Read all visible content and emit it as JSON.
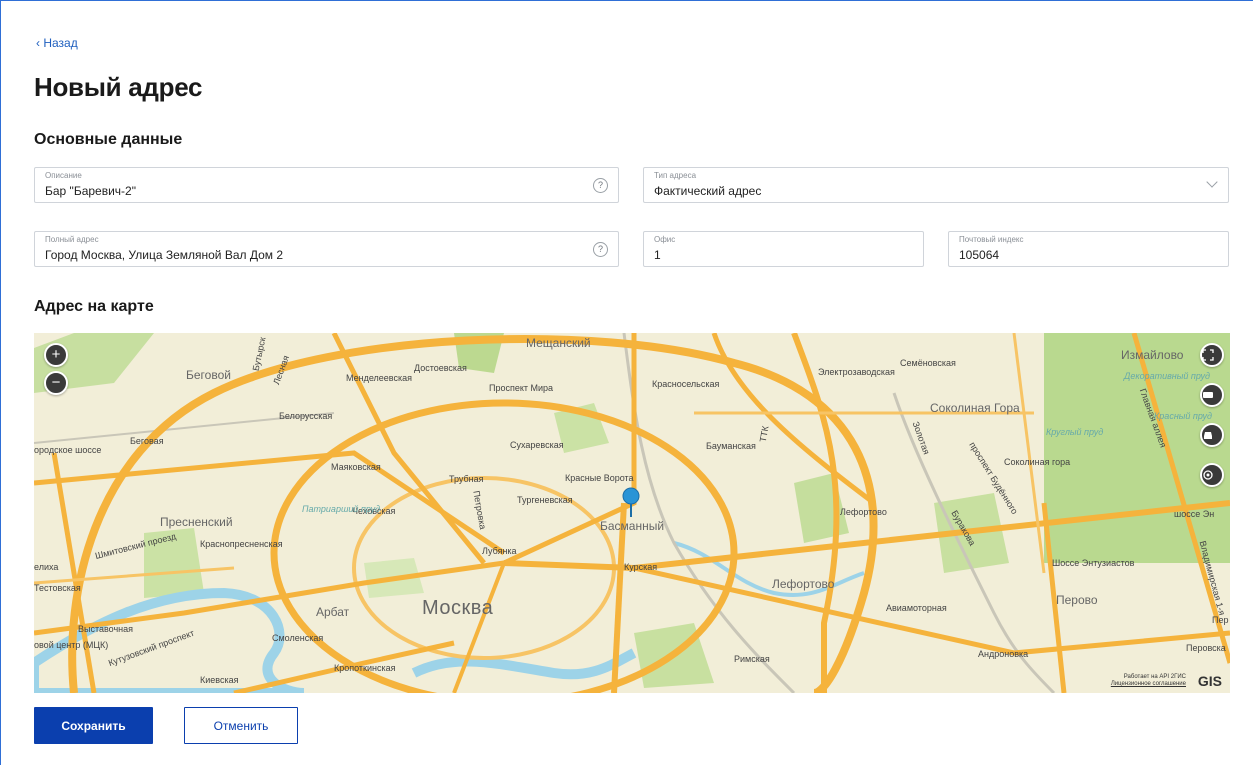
{
  "nav": {
    "back_label": "‹ Назад"
  },
  "page_title": "Новый адрес",
  "sections": {
    "main_title": "Основные данные",
    "map_title": "Адрес на карте"
  },
  "fields": {
    "description": {
      "label": "Описание",
      "value": "Бар \"Баревич-2\""
    },
    "address_type": {
      "label": "Тип адреса",
      "value": "Фактический адрес"
    },
    "full_address": {
      "label": "Полный адрес",
      "value": "Город Москва, Улица Земляной Вал Дом 2"
    },
    "office": {
      "label": "Офис",
      "value": "1"
    },
    "postal_code": {
      "label": "Почтовый индекс",
      "value": "105064"
    }
  },
  "help_glyph": "?",
  "map": {
    "zoom_in": "+",
    "zoom_out": "−",
    "labels": {
      "meshchansky": "Мещанский",
      "begovoy": "Беговой",
      "mendeleevskaya": "Менделеевская",
      "dostoevskaya": "Достоевская",
      "prospekt_mira": "Проспект Мира",
      "krasnoselskaya": "Красносельская",
      "elektrozavodskaya": "Электрозаводская",
      "semenovskaya": "Семёновская",
      "izmailovo": "Измайлово",
      "belorusskaya": "Белорусская",
      "begovaya": "Беговая",
      "sukharevskaya": "Сухаревская",
      "baumanskaya": "Бауманская",
      "sokolinaya_gora": "Соколиная Гора",
      "sokolinaya_gora2": "Соколиная гора",
      "mayakovskaya": "Маяковская",
      "trubnaya": "Трубная",
      "krasnye_vorota": "Красные Ворота",
      "turgenevskaya": "Тургеневская",
      "presnensky": "Пресненский",
      "chekhovskaya": "Чеховская",
      "patriarshiy": "Патриарший пруд",
      "basmanny": "Басманный",
      "lefortovo_st": "Лефортово",
      "krasnopresnenskaya": "Краснопресненская",
      "lubyanka": "Лубянка",
      "kurskaya": "Курская",
      "lefortovo": "Лефортово",
      "shosse_entuziastov": "Шоссе Энтузиастов",
      "testovskaya": "Тестовская",
      "arbat": "Арбат",
      "moskva": "Москва",
      "aviamotornaya": "Авиамоторная",
      "perovo": "Перово",
      "vystavochnaya": "Выставочная",
      "smolenskaya": "Смоленская",
      "mck": "овой центр (МЦК)",
      "rimskaya": "Римская",
      "andronovka": "Андроновка",
      "kropotkinskaya": "Кропоткинская",
      "kievskaya": "Киевская",
      "petrovka": "Петровка",
      "ttk": "ТТК",
      "shmitovsky": "Шмитовский проезд",
      "kutuzovsky": "Кутузовский проспект",
      "golovnaya": "Главная аллея",
      "dekorativny": "Декоративный пруд",
      "krugly": "Круглый пруд",
      "krasny": "Красный пруд",
      "perovskaya": "Перовска",
      "zolotaya": "Золотая",
      "budennogo": "проспект Будённого",
      "bakaninskaya": "Буракова",
      "butyrskaya": "Бутырск",
      "lesnaya": "Лесная",
      "vladimirskaya": "Владимирская 1-я",
      "shosse_left": "ородское шоссе",
      "shosse_right": "шоссе Эн",
      "pere": "Пер",
      "elikha": "елиха"
    },
    "attribution_line1": "Работает на API 2ГИС",
    "attribution_line2": "Лицензионное соглашение",
    "brand": "GIS"
  },
  "buttons": {
    "save": "Сохранить",
    "cancel": "Отменить"
  },
  "colors": {
    "accent": "#0b3fae",
    "link": "#1f5fbf",
    "map_road": "#f5b33c",
    "map_park": "#b9d98f",
    "map_water": "#9dd3e8",
    "pin": "#2a94d6"
  }
}
